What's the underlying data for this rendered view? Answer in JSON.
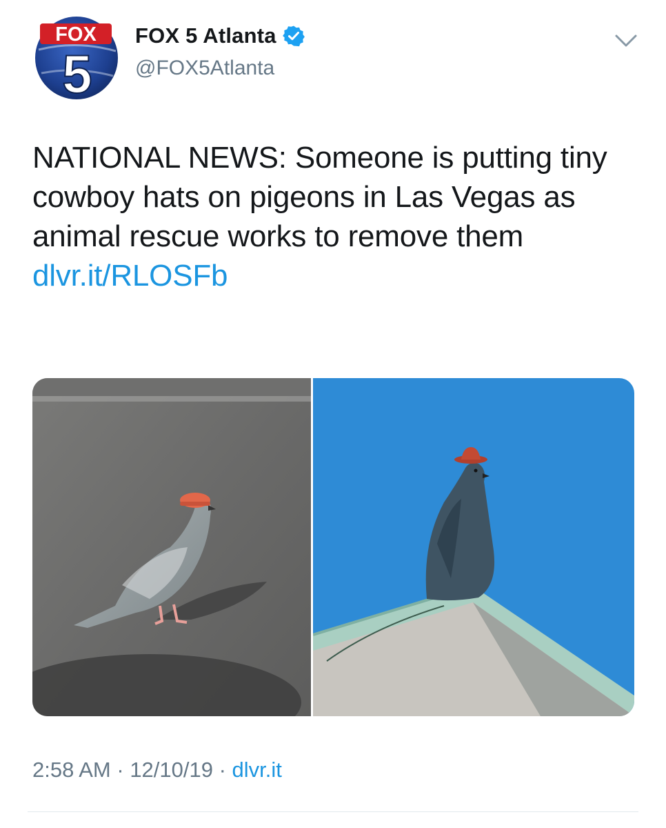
{
  "tweet": {
    "logo_text_top": "FOX",
    "logo_text_number": "5",
    "display_name": "FOX 5 Atlanta",
    "handle": "@FOX5Atlanta",
    "text": "NATIONAL NEWS: Someone is putting tiny cowboy hats on pigeons in Las Vegas as animal rescue works to remove them ",
    "link": "dlvr.it/RLOSFb",
    "time": "2:58 AM",
    "separator": " · ",
    "date": "12/10/19",
    "source": "dlvr.it"
  },
  "icons": {
    "verified": "verified-badge-icon",
    "caret": "chevron-down-icon"
  },
  "colors": {
    "link": "#1b95e0",
    "secondary_text": "#657786",
    "verified": "#1da1f2",
    "fox_red": "#d32027",
    "fox_blue": "#1d3f8f"
  },
  "media": [
    {
      "subject": "pigeon with red hat on asphalt"
    },
    {
      "subject": "pigeon with cowboy hat on rooftop"
    }
  ]
}
